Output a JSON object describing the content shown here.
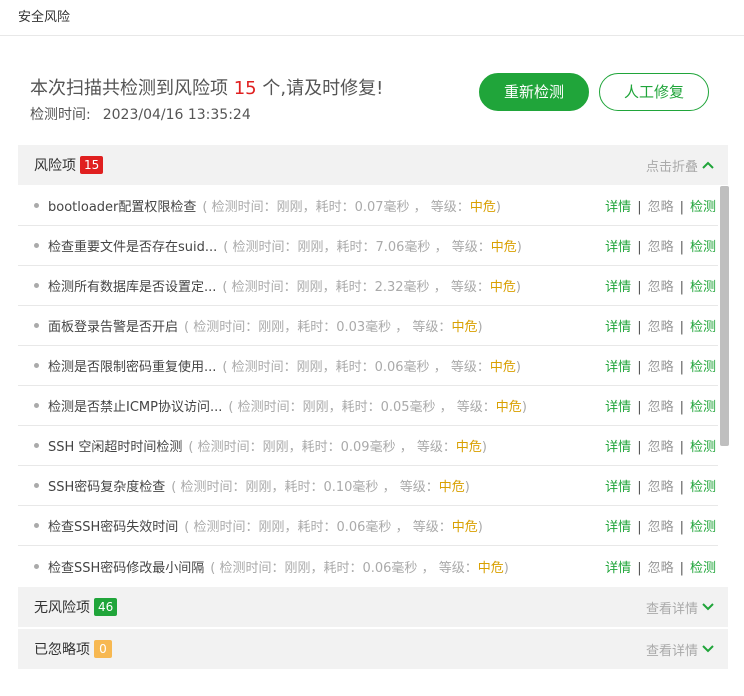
{
  "window": {
    "title": "安全风险"
  },
  "summary": {
    "prefix": "本次扫描共检测到风险项 ",
    "count": "15",
    "suffix": " 个,请及时修复!",
    "time_label": "检测时间:",
    "time_value": "2023/04/16 13:35:24"
  },
  "buttons": {
    "rescan": "重新检测",
    "manual_fix": "人工修复"
  },
  "risk_section": {
    "label": "风险项",
    "count": "15",
    "toggle": "点击折叠",
    "badge_color": "#e02020"
  },
  "risk_items": [
    {
      "name": "bootloader配置权限检查",
      "meta": "( 检测时间：刚刚，耗时：0.07毫秒 ， 等级：",
      "level": "中危",
      "close": ")"
    },
    {
      "name": "检查重要文件是否存在suid...",
      "meta": "( 检测时间：刚刚，耗时：7.06毫秒 ， 等级：",
      "level": "中危",
      "close": ")"
    },
    {
      "name": "检测所有数据库是否设置定...",
      "meta": "( 检测时间：刚刚，耗时：2.32毫秒 ， 等级：",
      "level": "中危",
      "close": ")"
    },
    {
      "name": "面板登录告警是否开启",
      "meta": "( 检测时间：刚刚，耗时：0.03毫秒 ， 等级：",
      "level": "中危",
      "close": ")"
    },
    {
      "name": "检测是否限制密码重复使用...",
      "meta": "( 检测时间：刚刚，耗时：0.06毫秒 ， 等级：",
      "level": "中危",
      "close": ")"
    },
    {
      "name": "检测是否禁止ICMP协议访问...",
      "meta": "( 检测时间：刚刚，耗时：0.05毫秒 ， 等级：",
      "level": "中危",
      "close": ")"
    },
    {
      "name": "SSH 空闲超时时间检测",
      "meta": "( 检测时间：刚刚，耗时：0.09毫秒 ， 等级：",
      "level": "中危",
      "close": ")"
    },
    {
      "name": "SSH密码复杂度检查",
      "meta": "( 检测时间：刚刚，耗时：0.10毫秒 ， 等级：",
      "level": "中危",
      "close": ")"
    },
    {
      "name": "检查SSH密码失效时间",
      "meta": "( 检测时间：刚刚，耗时：0.06毫秒 ， 等级：",
      "level": "中危",
      "close": ")"
    },
    {
      "name": "检查SSH密码修改最小间隔",
      "meta": "( 检测时间：刚刚，耗时：0.06毫秒 ， 等级：",
      "level": "中危",
      "close": ")"
    }
  ],
  "row_actions": {
    "detail": "详情",
    "ignore": "忽略",
    "check": "检测",
    "sep": "|"
  },
  "safe_section": {
    "label": "无风险项",
    "count": "46",
    "toggle": "查看详情",
    "badge_color": "#20a53a"
  },
  "ignored_section": {
    "label": "已忽略项",
    "count": "0",
    "toggle": "查看详情",
    "badge_color": "#f7b851"
  },
  "colors": {
    "accent": "#20a53a",
    "danger": "#e02020",
    "level_medium": "#d9a000"
  }
}
